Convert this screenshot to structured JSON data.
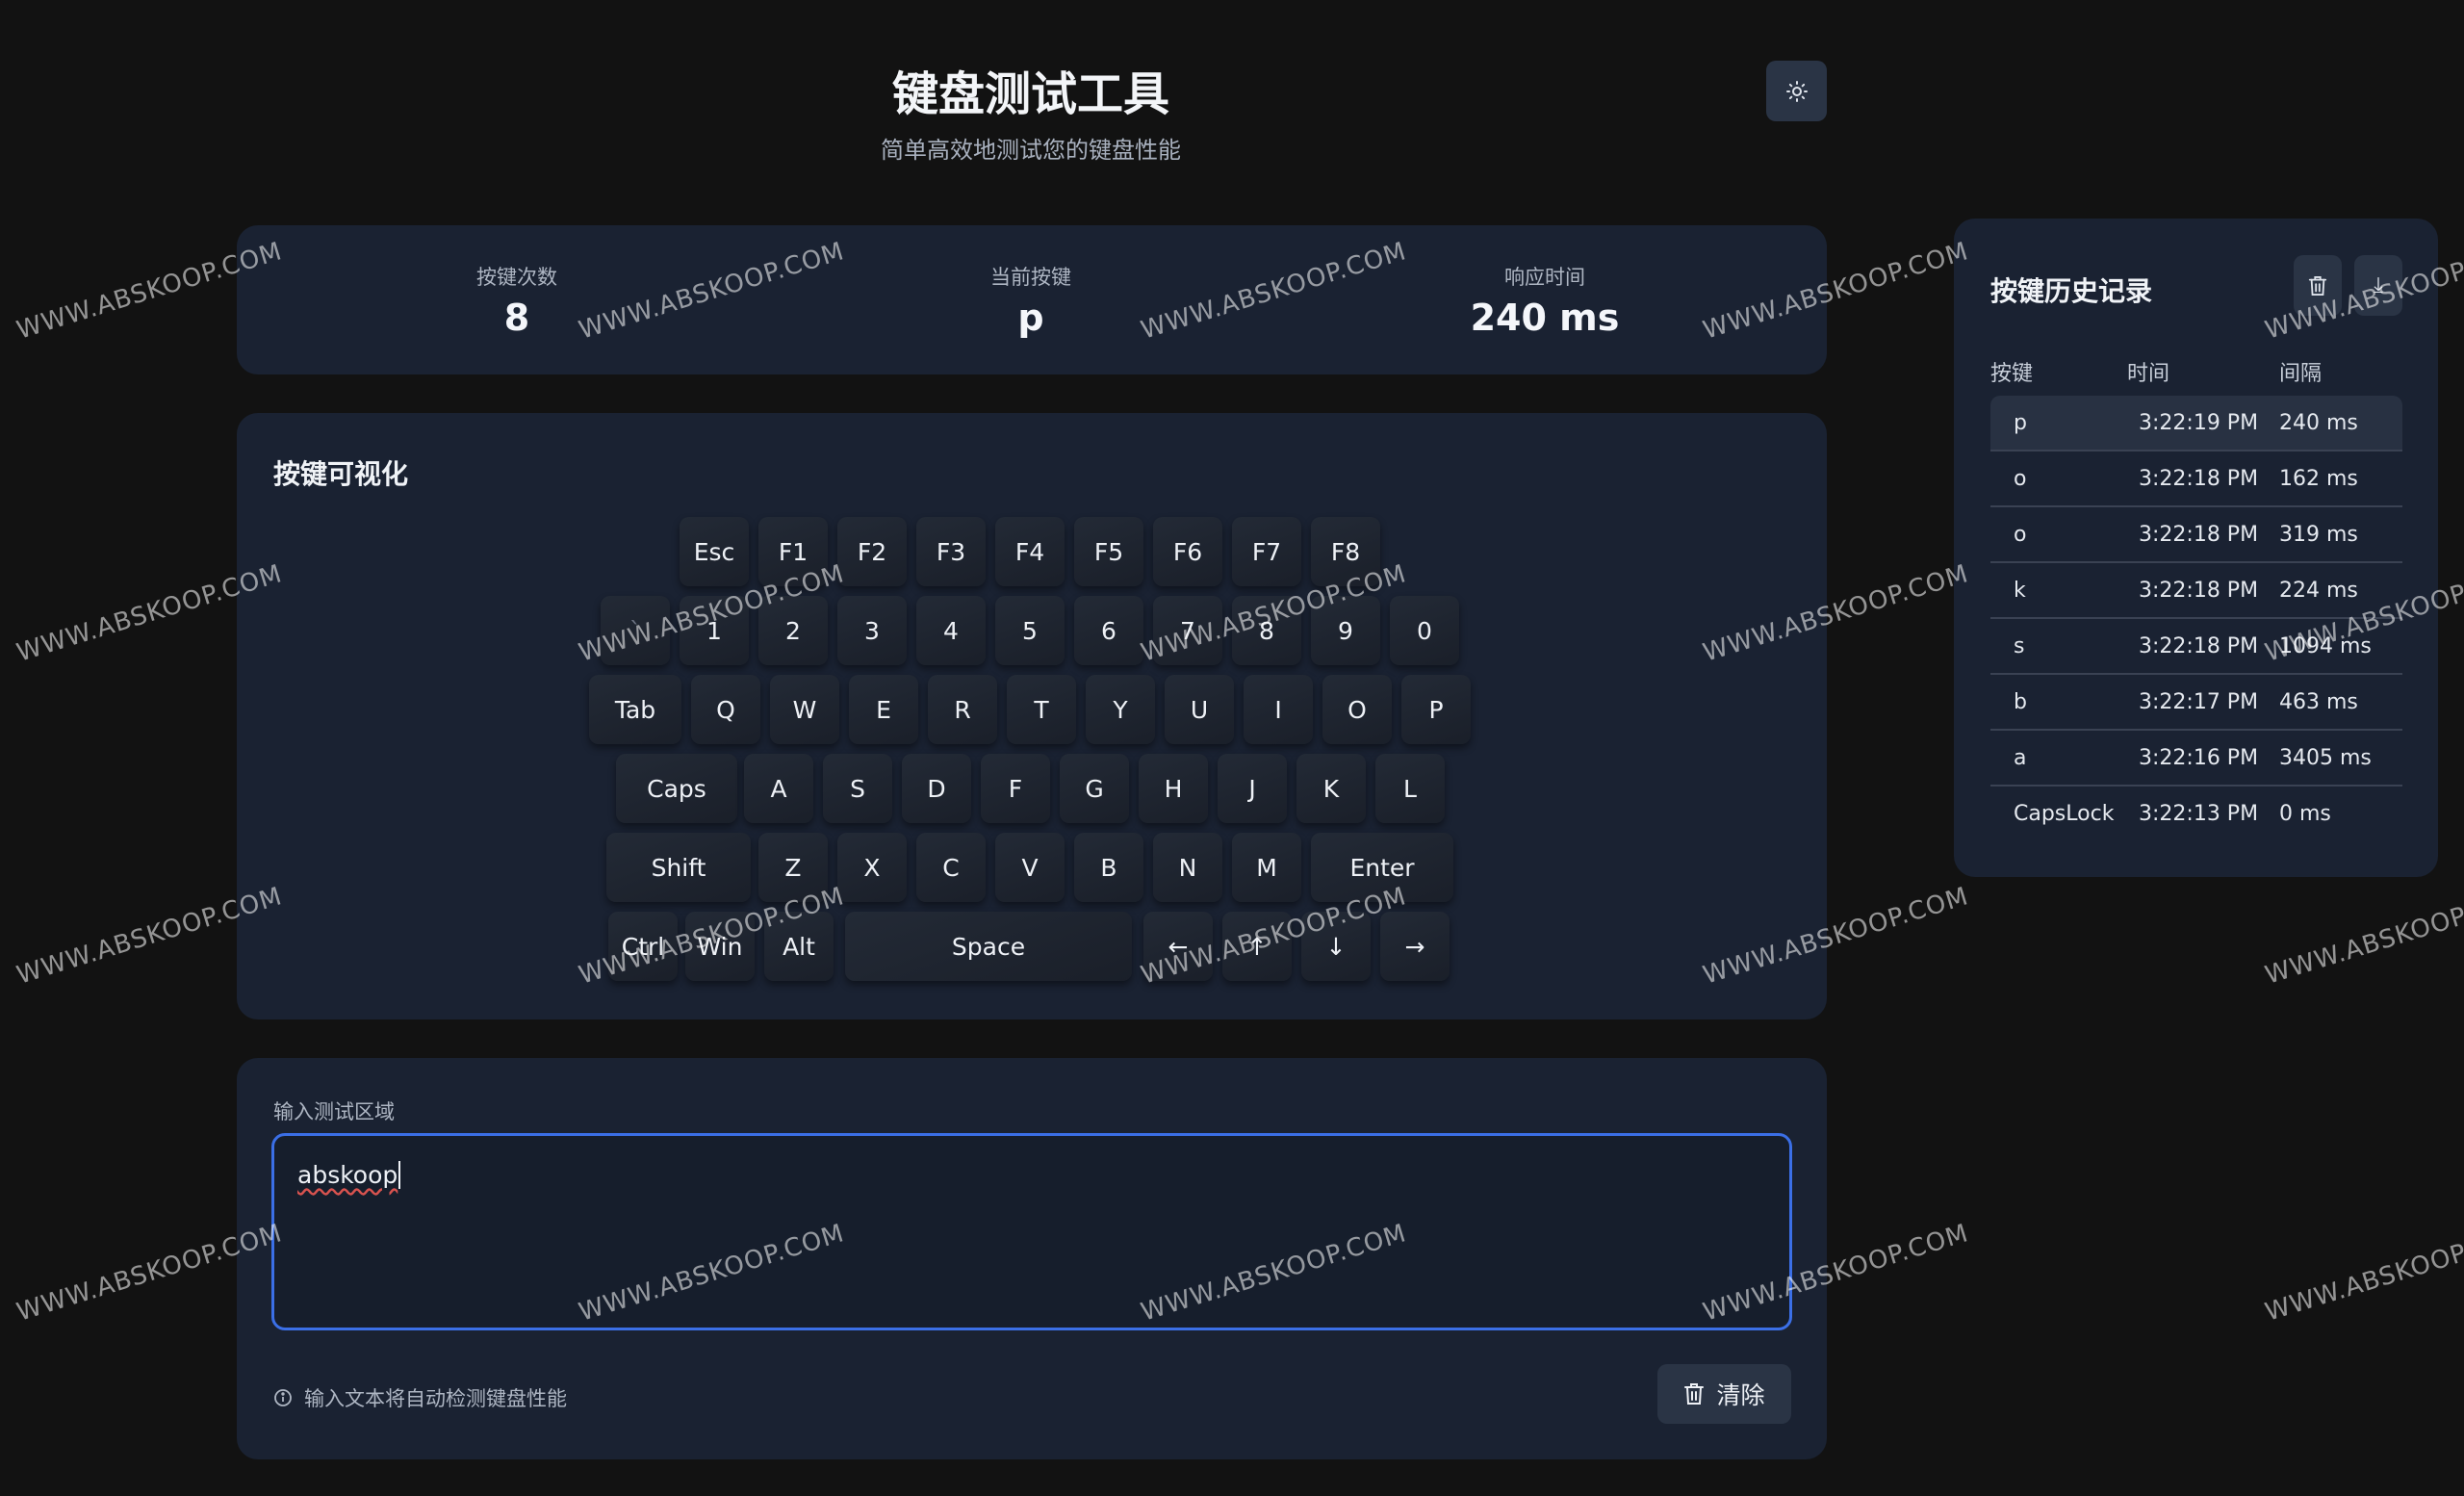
{
  "header": {
    "title": "键盘测试工具",
    "subtitle": "简单高效地测试您的键盘性能",
    "theme_icon": "sun-icon"
  },
  "stats": [
    {
      "label": "按键次数",
      "value": "8"
    },
    {
      "label": "当前按键",
      "value": "p"
    },
    {
      "label": "响应时间",
      "value": "240 ms"
    }
  ],
  "keyboard": {
    "title": "按键可视化",
    "rows": [
      [
        "Esc",
        "F1",
        "F2",
        "F3",
        "F4",
        "F5",
        "F6",
        "F7",
        "F8"
      ],
      [
        "`",
        "1",
        "2",
        "3",
        "4",
        "5",
        "6",
        "7",
        "8",
        "9",
        "0"
      ],
      [
        "Tab",
        "Q",
        "W",
        "E",
        "R",
        "T",
        "Y",
        "U",
        "I",
        "O",
        "P"
      ],
      [
        "Caps",
        "A",
        "S",
        "D",
        "F",
        "G",
        "H",
        "J",
        "K",
        "L"
      ],
      [
        "Shift",
        "Z",
        "X",
        "C",
        "V",
        "B",
        "N",
        "M",
        "Enter"
      ],
      [
        "Ctrl",
        "Win",
        "Alt",
        "Space",
        "←",
        "↑",
        "↓",
        "→"
      ]
    ]
  },
  "input": {
    "label": "输入测试区域",
    "value": "abskoop",
    "hint": "输入文本将自动检测键盘性能",
    "clear_label": "清除"
  },
  "history": {
    "title": "按键历史记录",
    "columns": [
      "按键",
      "时间",
      "间隔"
    ],
    "rows": [
      {
        "key": "p",
        "time": "3:22:19 PM",
        "interval": "240 ms"
      },
      {
        "key": "o",
        "time": "3:22:18 PM",
        "interval": "162 ms"
      },
      {
        "key": "o",
        "time": "3:22:18 PM",
        "interval": "319 ms"
      },
      {
        "key": "k",
        "time": "3:22:18 PM",
        "interval": "224 ms"
      },
      {
        "key": "s",
        "time": "3:22:18 PM",
        "interval": "1094 ms"
      },
      {
        "key": "b",
        "time": "3:22:17 PM",
        "interval": "463 ms"
      },
      {
        "key": "a",
        "time": "3:22:16 PM",
        "interval": "3405 ms"
      },
      {
        "key": "CapsLock",
        "time": "3:22:13 PM",
        "interval": "0 ms"
      }
    ]
  },
  "watermark": "WWW.ABSKOOP.COM"
}
